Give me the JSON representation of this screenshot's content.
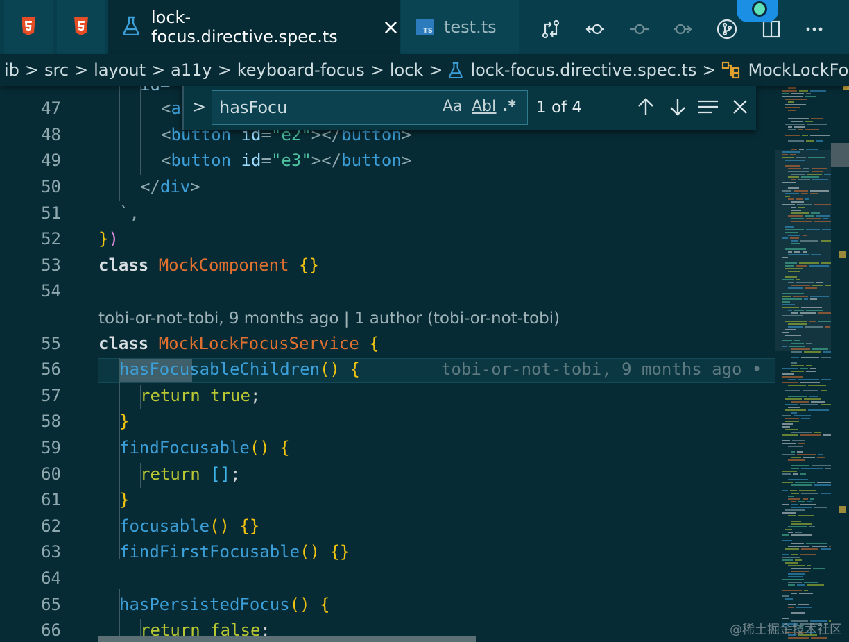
{
  "tabs": [
    {
      "icon": "html5-icon"
    },
    {
      "icon": "html5-icon"
    },
    {
      "label": "lock-focus.directive.spec.ts",
      "icon": "beaker-icon",
      "active": true,
      "close_glyph": "×"
    },
    {
      "label": "test.ts",
      "icon": "typescript-icon",
      "active": false,
      "icon_text": "TS"
    }
  ],
  "toolbar": [
    "git-compare-icon",
    "go-back-icon",
    "git-commit-icon",
    "go-forward-icon",
    "source-control-icon",
    "split-editor-icon",
    "more-actions-icon"
  ],
  "breadcrumb": {
    "items": [
      "ib",
      "src",
      "layout",
      "a11y",
      "keyboard-focus",
      "lock",
      "lock-focus.directive.spec.ts",
      "MockLockFocusSe"
    ],
    "separator": ">"
  },
  "find": {
    "value": "hasFocu",
    "match_case": "Aa",
    "whole_word": "AbI",
    "regex": ".*",
    "count": "1 of 4",
    "toggle_glyph": ">"
  },
  "gutter": [
    "47",
    "48",
    "49",
    "50",
    "51",
    "52",
    "53",
    "54",
    "55",
    "56",
    "57",
    "58",
    "59",
    "60",
    "61",
    "62",
    "63",
    "64",
    "65",
    "66"
  ],
  "code": {
    "l46_fragment": "id=",
    "l47": {
      "open": "<",
      "tag": "a"
    },
    "l48": {
      "open": "<",
      "tag": "button",
      "attr": "id",
      "eq": "=",
      "val": "\"e2\"",
      "close1": "></",
      "tag2": "button",
      "close2": ">"
    },
    "l49": {
      "open": "<",
      "tag": "button",
      "attr": "id",
      "eq": "=",
      "val": "\"e3\"",
      "close1": "></",
      "tag2": "button",
      "close2": ">"
    },
    "l50": {
      "open": "</",
      "tag": "div",
      "close": ">"
    },
    "l51": "`,",
    "l52": {
      "p1": "}",
      "p2": ")"
    },
    "l53": {
      "kw": "class",
      "name": "MockComponent",
      "body": "{}"
    },
    "blame": "tobi-or-not-tobi, 9 months ago | 1 author (tobi-or-not-tobi)",
    "l55": {
      "kw": "class",
      "name": "MockLockFocusService",
      "brace": "{"
    },
    "l56": {
      "fn": "hasFocusableChildren",
      "parens": "()",
      "brace": "{",
      "inline_blame": "tobi-or-not-tobi, 9 months ago •"
    },
    "l57": {
      "kw": "return",
      "val": "true",
      "semi": ";"
    },
    "l58": "}",
    "l59": {
      "fn": "findFocusable",
      "parens": "()",
      "brace": "{"
    },
    "l60": {
      "kw": "return",
      "val": "[]",
      "semi": ";"
    },
    "l61": "}",
    "l62": {
      "fn": "focusable",
      "parens": "()",
      "body": "{}"
    },
    "l63": {
      "fn": "findFirstFocusable",
      "parens": "()",
      "body": "{}"
    },
    "l65": {
      "fn": "hasPersistedFocus",
      "parens": "()",
      "brace": "{"
    },
    "l66": {
      "kw": "return",
      "val": "false",
      "semi": ";"
    }
  },
  "watermark": "@稀土掘金技术社区",
  "colors": {
    "background": "#072b35",
    "keyword": "#d7dde0",
    "class_name": "#e0702f",
    "function": "#3c9fd8",
    "string": "#4fc3a1",
    "literal": "#b9c832"
  }
}
